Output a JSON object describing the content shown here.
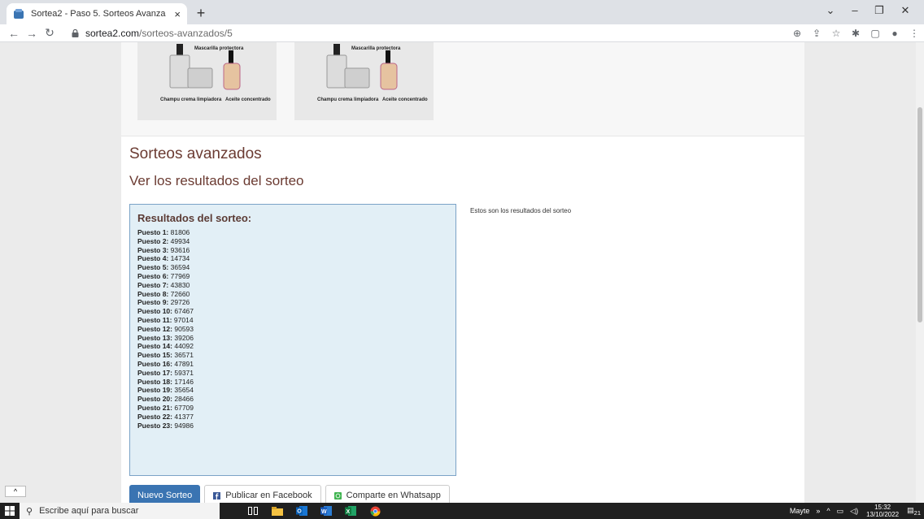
{
  "browser": {
    "tab_title": "Sortea2 - Paso 5. Sorteos Avanza",
    "tab_close": "×",
    "new_tab": "+",
    "url_host": "sortea2.com",
    "url_path": "/sorteos-avanzados/5",
    "win_min": "–",
    "win_restore": "❐",
    "win_close": "✕",
    "menu_down": "⌄"
  },
  "page": {
    "title": "Sorteos avanzados",
    "subtitle": "Ver los resultados del sorteo",
    "results_title": "Resultados del sorteo:",
    "side_note": "Estos son los resultados del sorteo",
    "results": [
      {
        "label": "Puesto 1:",
        "value": "81806"
      },
      {
        "label": "Puesto 2:",
        "value": "49934"
      },
      {
        "label": "Puesto 3:",
        "value": "93616"
      },
      {
        "label": "Puesto 4:",
        "value": "14734"
      },
      {
        "label": "Puesto 5:",
        "value": "36594"
      },
      {
        "label": "Puesto 6:",
        "value": "77969"
      },
      {
        "label": "Puesto 7:",
        "value": "43830"
      },
      {
        "label": "Puesto 8:",
        "value": "72660"
      },
      {
        "label": "Puesto 9:",
        "value": "29726"
      },
      {
        "label": "Puesto 10:",
        "value": "67467"
      },
      {
        "label": "Puesto 11:",
        "value": "97014"
      },
      {
        "label": "Puesto 12:",
        "value": "90593"
      },
      {
        "label": "Puesto 13:",
        "value": "39206"
      },
      {
        "label": "Puesto 14:",
        "value": "44092"
      },
      {
        "label": "Puesto 15:",
        "value": "36571"
      },
      {
        "label": "Puesto 16:",
        "value": "47891"
      },
      {
        "label": "Puesto 17:",
        "value": "59371"
      },
      {
        "label": "Puesto 18:",
        "value": "17146"
      },
      {
        "label": "Puesto 19:",
        "value": "35654"
      },
      {
        "label": "Puesto 20:",
        "value": "28466"
      },
      {
        "label": "Puesto 21:",
        "value": "67709"
      },
      {
        "label": "Puesto 22:",
        "value": "41377"
      },
      {
        "label": "Puesto 23:",
        "value": "94986"
      }
    ],
    "buttons": {
      "new_draw": "Nuevo Sorteo",
      "facebook": "Publicar en Facebook",
      "whatsapp": "Comparte en Whatsapp"
    },
    "product_images": [
      {
        "label_top": "Mascarilla protectora",
        "label_left": "Champu crema limpiadora",
        "label_right": "Aceite concentrado"
      },
      {
        "label_top": "Mascarilla protectora",
        "label_left": "Champu crema limpiadora",
        "label_right": "Aceite concentrado"
      }
    ]
  },
  "taskbar": {
    "search_placeholder": "Escribe aquí para buscar",
    "user": "Mayte",
    "time": "15:32",
    "date": "13/10/2022",
    "notif_count": "21"
  },
  "colors": {
    "heading": "#6b3b32",
    "results_bg": "#e2eff6",
    "results_border": "#7ba3c7",
    "primary_button": "#3a74b2"
  }
}
